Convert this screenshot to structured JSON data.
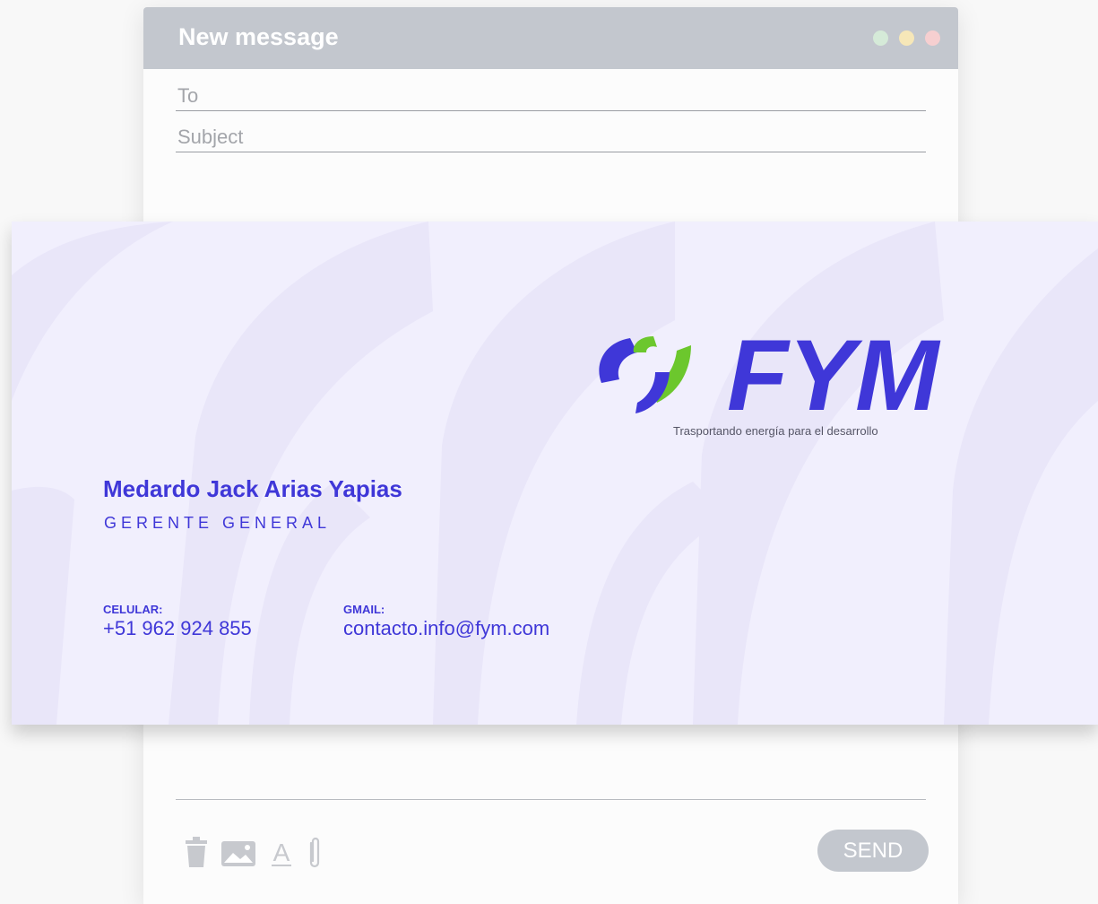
{
  "window": {
    "title": "New message",
    "controls": [
      "green-dot",
      "yellow-dot",
      "red-dot"
    ]
  },
  "fields": {
    "to_label": "To",
    "subject_label": "Subject"
  },
  "signature": {
    "logo_text": "FYM",
    "tagline": "Trasportando energía para el desarrollo",
    "name": "Medardo Jack Arias Yapias",
    "role": "GERENTE GENERAL",
    "phone_label": "CELULAR:",
    "phone": "+51 962 924 855",
    "email_label": "GMAIL:",
    "email": "contacto.info@fym.com",
    "colors": {
      "brand_blue": "#3f37d8",
      "brand_green": "#6cc72d",
      "card_bg": "#f1effd"
    }
  },
  "toolbar": {
    "icons": [
      "trash-icon",
      "image-icon",
      "text-format-icon",
      "attachment-icon"
    ],
    "send_label": "SEND"
  }
}
